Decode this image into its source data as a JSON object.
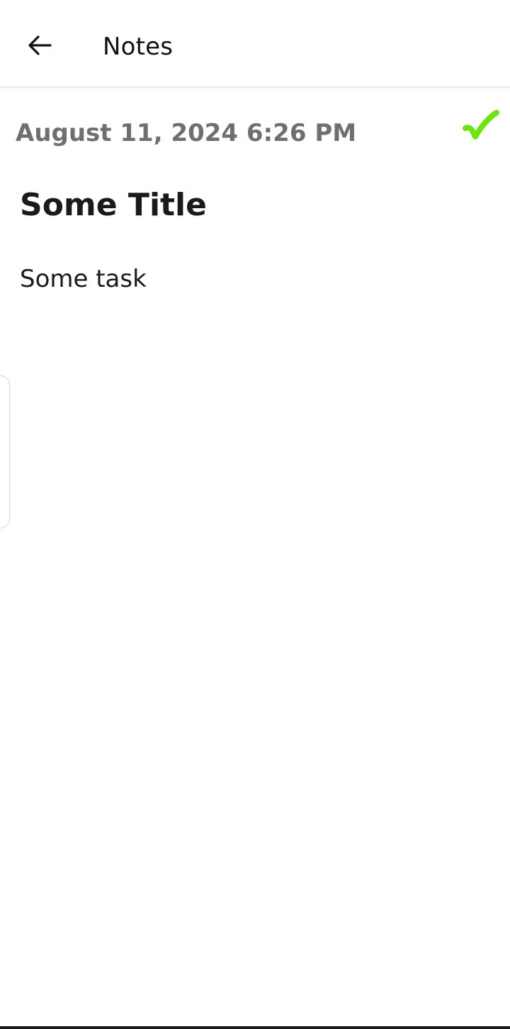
{
  "appbar": {
    "title": "Notes",
    "back_icon": "arrow-left-icon"
  },
  "note": {
    "timestamp": "August 11, 2024 6:26 PM",
    "title": "Some Title",
    "body": "Some task",
    "done_icon": "checkmark-icon",
    "done_color": "#6fe311"
  }
}
